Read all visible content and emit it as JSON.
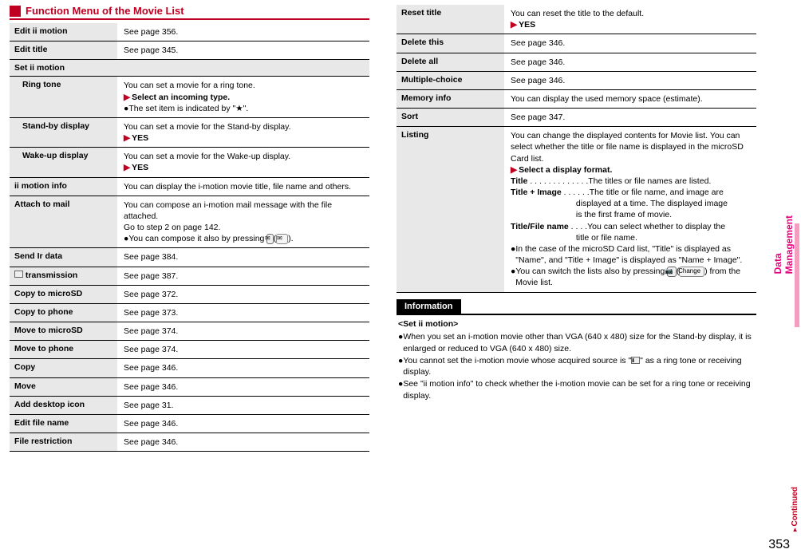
{
  "section_header": "Function Menu of the Movie List",
  "side_tab": "Data Management",
  "page_number": "353",
  "continued": "Continued",
  "left_rows": {
    "edit_i_motion": {
      "label": "Edit ii motion",
      "desc": "See page 356."
    },
    "edit_title": {
      "label": "Edit title",
      "desc": "See page 345."
    },
    "set_i_motion": {
      "label": "Set ii motion"
    },
    "ring_tone": {
      "label": "Ring tone",
      "line1": "You can set a movie for a ring tone.",
      "line2": "Select an incoming type.",
      "line3": "●The set item is indicated by \"★\"."
    },
    "standby": {
      "label": "Stand-by display",
      "line1": "You can set a movie for the Stand-by display.",
      "yes": "YES"
    },
    "wakeup": {
      "label": "Wake-up display",
      "line1": "You can set a movie for the Wake-up display.",
      "yes": "YES"
    },
    "motion_info": {
      "label": "ii motion info",
      "desc": "You can display the i-motion movie title, file name and others."
    },
    "attach_mail": {
      "label": "Attach to mail",
      "line1": "You can compose an i-motion mail message with the file attached.",
      "line2": "Go to step 2 on page 142.",
      "line3": "●You can compose it also by pressing ",
      "line3b": "(",
      "line3c": ")."
    },
    "send_ir": {
      "label": "Send Ir data",
      "desc": "See page 384."
    },
    "ic_trans": {
      "label": "transmission",
      "desc": "See page 387."
    },
    "copy_sd": {
      "label": "Copy to microSD",
      "desc": "See page 372."
    },
    "copy_phone": {
      "label": "Copy to phone",
      "desc": "See page 373."
    },
    "move_sd": {
      "label": "Move to microSD",
      "desc": "See page 374."
    },
    "move_phone": {
      "label": "Move to phone",
      "desc": "See page 374."
    },
    "copy": {
      "label": "Copy",
      "desc": "See page 346."
    },
    "move": {
      "label": "Move",
      "desc": "See page 346."
    },
    "desktop": {
      "label": "Add desktop icon",
      "desc": "See page 31."
    },
    "edit_file": {
      "label": "Edit file name",
      "desc": "See page 346."
    },
    "file_restrict": {
      "label": "File restriction",
      "desc": "See page 346."
    }
  },
  "right_rows": {
    "reset_title": {
      "label": "Reset title",
      "line1": "You can reset the title to the default.",
      "yes": "YES"
    },
    "delete_this": {
      "label": "Delete this",
      "desc": "See page 346."
    },
    "delete_all": {
      "label": "Delete all",
      "desc": "See page 346."
    },
    "multiple": {
      "label": "Multiple-choice",
      "desc": "See page 346."
    },
    "memory": {
      "label": "Memory info",
      "desc": "You can display the used memory space (estimate)."
    },
    "sort": {
      "label": "Sort",
      "desc": "See page 347."
    },
    "listing": {
      "label": "Listing",
      "line1": "You can change the displayed contents for Movie list. You can select whether the title or file name is displayed in the microSD Card list.",
      "select_format": "Select a display format.",
      "title_lbl": "Title",
      "title_desc": " . . . . . . . . . . . . .The titles or file names are listed.",
      "title_img_lbl": "Title + Image",
      "title_img_desc": " . . . . . .The title or file name, and image are displayed at a time. The displayed image is the first frame of movie.",
      "title_img_desc2a": "displayed at a time. The displayed image",
      "title_img_desc2b": "is the first frame of movie.",
      "tfn_lbl": "Title/File name",
      "tfn_desc": "  . . . .You can select whether to display the title or file name.",
      "tfn_desc2": "title or file name.",
      "bullet1": "●In the case of the microSD Card list, \"Title\" is displayed as \"Name\", and \"Title + Image\" is displayed as \"Name + Image\".",
      "bullet2a": "●You can switch the lists also by pressing ",
      "bullet2b": "(",
      "bullet2c": ") from the Movie list.",
      "change_btn": "Change"
    }
  },
  "info": {
    "header": "Information",
    "sub": "<Set ii motion>",
    "b1": "●When you set an i-motion movie other than VGA (640 x 480) size for the Stand-by display, it is enlarged or reduced to VGA (640 x 480) size.",
    "b2a": "●You cannot set the i-motion movie whose acquired source is \"",
    "b2b": "\" as a ring tone or receiving display.",
    "b3": "●See \"ii motion info\" to check whether the i-motion movie can be set for a ring tone or receiving display."
  }
}
